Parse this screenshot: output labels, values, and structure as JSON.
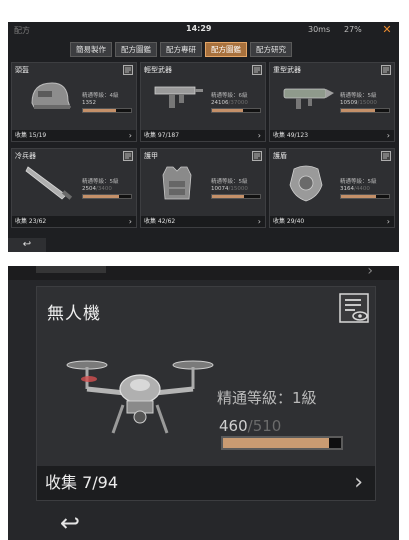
{
  "status_bar": {
    "left_text": "配方",
    "time": "14:29",
    "signal": "30ms",
    "battery": "27%"
  },
  "tabs": [
    {
      "label": "簡易製作",
      "active": false
    },
    {
      "label": "配方圖鑑",
      "active": false
    },
    {
      "label": "配方專研",
      "active": false
    },
    {
      "label": "配方圖鑑",
      "active": true
    },
    {
      "label": "配方研究",
      "active": false
    }
  ],
  "cards": [
    {
      "title": "頭盔",
      "level": "精通等級：4級",
      "current": "1352",
      "max": "",
      "fill": 0.68,
      "collect": "收集 15/19",
      "icon": "helmet-icon"
    },
    {
      "title": "輕型武器",
      "level": "精通等級：6級",
      "current": "24106",
      "max": "/37000",
      "fill": 0.65,
      "collect": "收集 97/187",
      "icon": "smg-icon"
    },
    {
      "title": "重型武器",
      "level": "精通等級：5級",
      "current": "10509",
      "max": "/15000",
      "fill": 0.7,
      "collect": "收集 49/123",
      "icon": "launcher-icon"
    },
    {
      "title": "冷兵器",
      "level": "精通等級：5級",
      "current": "2504",
      "max": "/3400",
      "fill": 0.74,
      "collect": "收集 23/62",
      "icon": "blade-icon"
    },
    {
      "title": "護甲",
      "level": "精通等級：5級",
      "current": "10074",
      "max": "/15000",
      "fill": 0.67,
      "collect": "收集 42/62",
      "icon": "armor-vest-icon"
    },
    {
      "title": "護盾",
      "level": "精通等級：5級",
      "current": "3164",
      "max": "/4400",
      "fill": 0.72,
      "collect": "收集 29/40",
      "icon": "shield-icon"
    }
  ],
  "back_label": "↩",
  "zoom": {
    "title": "無人機",
    "level": "精通等級：1級",
    "current": "460",
    "max": "/510",
    "fill": 0.9,
    "collect": "收集 7/94",
    "icon": "drone-icon"
  },
  "colors": {
    "accent_orange": "#a8713d",
    "bar_fill": "#c49069",
    "close_icon": "#ef8d2e"
  }
}
